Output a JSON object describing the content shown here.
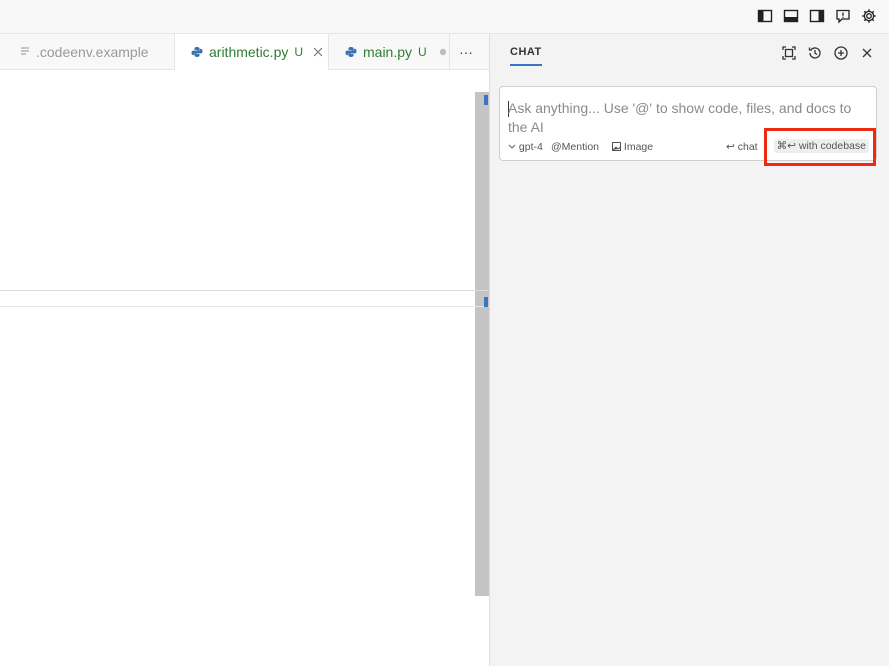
{
  "tabs": [
    {
      "label": ".codeenv.example",
      "modified": "",
      "icon": "file-lines-icon",
      "active": false
    },
    {
      "label": "arithmetic.py",
      "modified": "U",
      "icon": "python-icon",
      "active": true
    },
    {
      "label": "main.py",
      "modified": "U",
      "icon": "python-icon",
      "active": false
    }
  ],
  "tab_more": "···",
  "chat": {
    "title": "CHAT",
    "input_placeholder": "Ask anything... Use '@' to show code, files, and docs to the AI",
    "model": "gpt-4",
    "mention_label": "Mention",
    "image_label": "Image",
    "chat_label": "chat",
    "codebase_label": "with codebase",
    "codebase_shortcut": "⌘↩"
  },
  "colors": {
    "accent": "#3a75c4",
    "modified": "#2f7d32",
    "highlight": "#ee2a12"
  }
}
